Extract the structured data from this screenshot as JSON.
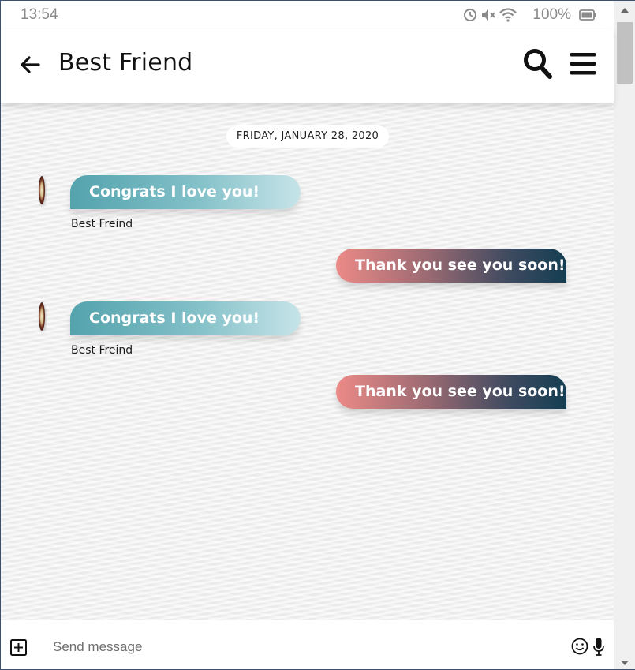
{
  "status_bar": {
    "time": "13:54",
    "battery_percent": "100%",
    "icons": [
      "alarm-icon",
      "mute-icon",
      "wifi-icon",
      "battery-icon"
    ]
  },
  "header": {
    "title": "Best Friend",
    "back_icon": "arrow-left-icon",
    "search_icon": "search-icon",
    "menu_icon": "hamburger-menu-icon"
  },
  "chat": {
    "date_label": "FRIDAY, JANUARY 28, 2020",
    "messages": [
      {
        "direction": "incoming",
        "text": "Congrats I love you!",
        "sender": "Best Freind"
      },
      {
        "direction": "outgoing",
        "text": "Thank you see you soon!"
      },
      {
        "direction": "incoming",
        "text": "Congrats I love you!",
        "sender": "Best Freind"
      },
      {
        "direction": "outgoing",
        "text": "Thank you see you soon!"
      }
    ]
  },
  "input_bar": {
    "placeholder": "Send message",
    "value": "",
    "attach_icon": "plus-square-icon",
    "emoji_icon": "smiley-icon",
    "mic_icon": "microphone-icon"
  },
  "colors": {
    "incoming_bubble_start": "#53a3ad",
    "incoming_bubble_end": "#c6e4e8",
    "outgoing_bubble_start": "#ec8a87",
    "outgoing_bubble_end": "#143e52",
    "chat_background": "#f1f1f1"
  }
}
